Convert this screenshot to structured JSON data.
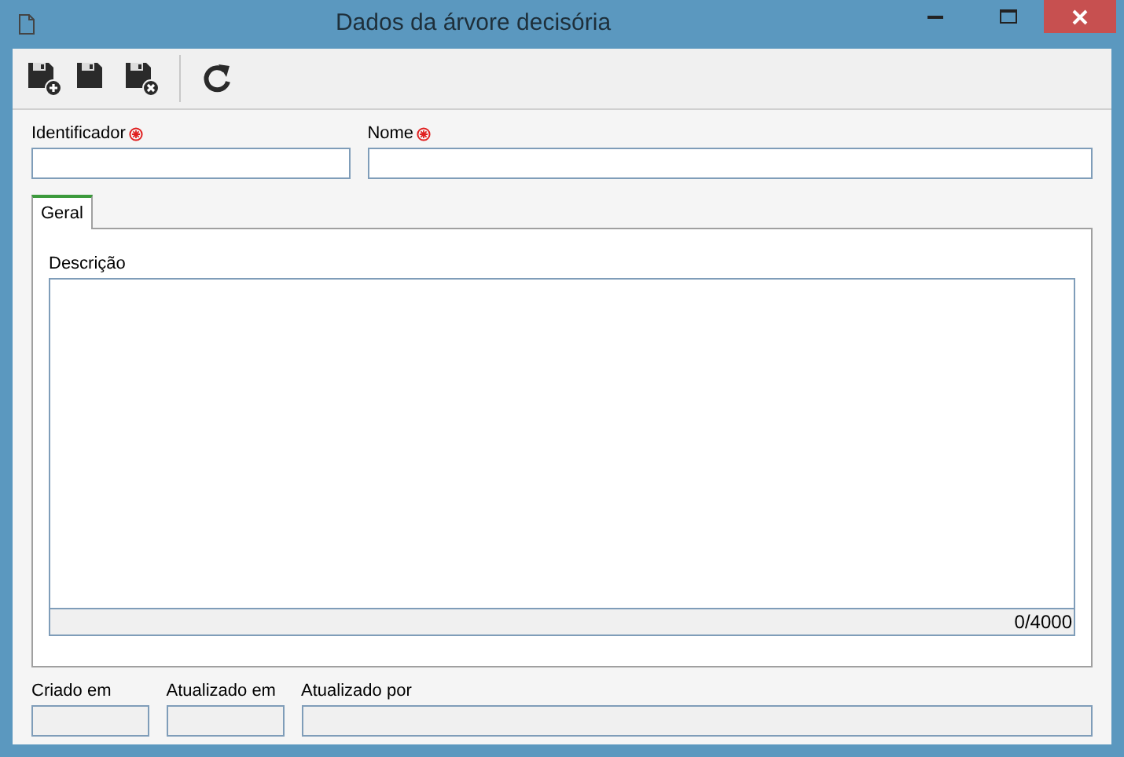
{
  "window": {
    "title": "Dados da árvore decisória"
  },
  "toolbar": [
    {
      "kind": "save-new"
    },
    {
      "kind": "save"
    },
    {
      "kind": "save-close"
    },
    {
      "kind": "separator"
    },
    {
      "kind": "refresh"
    }
  ],
  "fields": [
    {
      "label": "Identificador",
      "required": true
    },
    {
      "label": "Nome",
      "required": true
    }
  ],
  "tabs": [
    {
      "label": "Geral",
      "selected": true
    }
  ],
  "description": {
    "label": "Descrição",
    "counter": "0/4000"
  },
  "footer_fields": [
    {
      "label": "Criado em",
      "disabled": true
    },
    {
      "label": "Atualizado em",
      "disabled": true
    },
    {
      "label": "Atualizado por",
      "disabled": true
    }
  ]
}
